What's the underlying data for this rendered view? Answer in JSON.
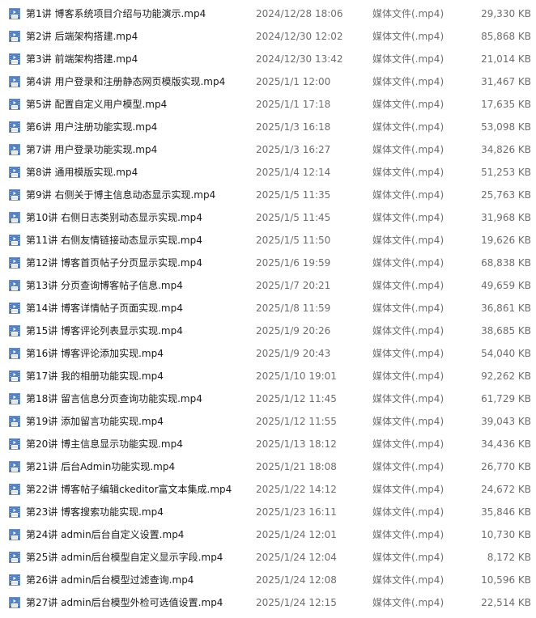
{
  "file_list": {
    "icon": "video-file-icon",
    "items": [
      {
        "name": "第1讲 博客系统项目介绍与功能演示.mp4",
        "date": "2024/12/28 18:06",
        "type": "媒体文件(.mp4)",
        "size": "29,330 KB"
      },
      {
        "name": "第2讲 后端架构搭建.mp4",
        "date": "2024/12/30 12:02",
        "type": "媒体文件(.mp4)",
        "size": "85,868 KB"
      },
      {
        "name": "第3讲 前端架构搭建.mp4",
        "date": "2024/12/30 13:42",
        "type": "媒体文件(.mp4)",
        "size": "21,014 KB"
      },
      {
        "name": "第4讲 用户登录和注册静态网页模版实现.mp4",
        "date": "2025/1/1 12:00",
        "type": "媒体文件(.mp4)",
        "size": "31,467 KB"
      },
      {
        "name": "第5讲 配置自定义用户模型.mp4",
        "date": "2025/1/1 17:18",
        "type": "媒体文件(.mp4)",
        "size": "17,635 KB"
      },
      {
        "name": "第6讲 用户注册功能实现.mp4",
        "date": "2025/1/3 16:18",
        "type": "媒体文件(.mp4)",
        "size": "53,098 KB"
      },
      {
        "name": "第7讲 用户登录功能实现.mp4",
        "date": "2025/1/3 16:27",
        "type": "媒体文件(.mp4)",
        "size": "34,826 KB"
      },
      {
        "name": "第8讲 通用模版实现.mp4",
        "date": "2025/1/4 12:14",
        "type": "媒体文件(.mp4)",
        "size": "51,253 KB"
      },
      {
        "name": "第9讲 右侧关于博主信息动态显示实现.mp4",
        "date": "2025/1/5 11:35",
        "type": "媒体文件(.mp4)",
        "size": "25,763 KB"
      },
      {
        "name": "第10讲 右侧日志类别动态显示实现.mp4",
        "date": "2025/1/5 11:45",
        "type": "媒体文件(.mp4)",
        "size": "31,968 KB"
      },
      {
        "name": "第11讲 右侧友情链接动态显示实现.mp4",
        "date": "2025/1/5 11:50",
        "type": "媒体文件(.mp4)",
        "size": "19,626 KB"
      },
      {
        "name": "第12讲 博客首页帖子分页显示实现.mp4",
        "date": "2025/1/6 19:59",
        "type": "媒体文件(.mp4)",
        "size": "68,838 KB"
      },
      {
        "name": "第13讲 分页查询博客帖子信息.mp4",
        "date": "2025/1/7 20:21",
        "type": "媒体文件(.mp4)",
        "size": "49,659 KB"
      },
      {
        "name": "第14讲 博客详情帖子页面实现.mp4",
        "date": "2025/1/8 11:59",
        "type": "媒体文件(.mp4)",
        "size": "36,861 KB"
      },
      {
        "name": "第15讲 博客评论列表显示实现.mp4",
        "date": "2025/1/9 20:26",
        "type": "媒体文件(.mp4)",
        "size": "38,685 KB"
      },
      {
        "name": "第16讲 博客评论添加实现.mp4",
        "date": "2025/1/9 20:43",
        "type": "媒体文件(.mp4)",
        "size": "54,040 KB"
      },
      {
        "name": "第17讲 我的相册功能实现.mp4",
        "date": "2025/1/10 19:01",
        "type": "媒体文件(.mp4)",
        "size": "92,262 KB"
      },
      {
        "name": "第18讲 留言信息分页查询功能实现.mp4",
        "date": "2025/1/12 11:45",
        "type": "媒体文件(.mp4)",
        "size": "61,729 KB"
      },
      {
        "name": "第19讲 添加留言功能实现.mp4",
        "date": "2025/1/12 11:55",
        "type": "媒体文件(.mp4)",
        "size": "39,043 KB"
      },
      {
        "name": "第20讲 博主信息显示功能实现.mp4",
        "date": "2025/1/13 18:12",
        "type": "媒体文件(.mp4)",
        "size": "34,436 KB"
      },
      {
        "name": "第21讲 后台Admin功能实现.mp4",
        "date": "2025/1/21 18:08",
        "type": "媒体文件(.mp4)",
        "size": "26,770 KB"
      },
      {
        "name": "第22讲 博客帖子编辑ckeditor富文本集成.mp4",
        "date": "2025/1/22 14:12",
        "type": "媒体文件(.mp4)",
        "size": "24,672 KB"
      },
      {
        "name": "第23讲 博客搜索功能实现.mp4",
        "date": "2025/1/23 16:11",
        "type": "媒体文件(.mp4)",
        "size": "35,846 KB"
      },
      {
        "name": "第24讲 admin后台自定义设置.mp4",
        "date": "2025/1/24 12:01",
        "type": "媒体文件(.mp4)",
        "size": "10,730 KB"
      },
      {
        "name": "第25讲 admin后台模型自定义显示字段.mp4",
        "date": "2025/1/24 12:04",
        "type": "媒体文件(.mp4)",
        "size": "8,172 KB"
      },
      {
        "name": "第26讲 admin后台模型过滤查询.mp4",
        "date": "2025/1/24 12:08",
        "type": "媒体文件(.mp4)",
        "size": "10,596 KB"
      },
      {
        "name": "第27讲 admin后台模型外检可选值设置.mp4",
        "date": "2025/1/24 12:15",
        "type": "媒体文件(.mp4)",
        "size": "22,514 KB"
      }
    ]
  }
}
